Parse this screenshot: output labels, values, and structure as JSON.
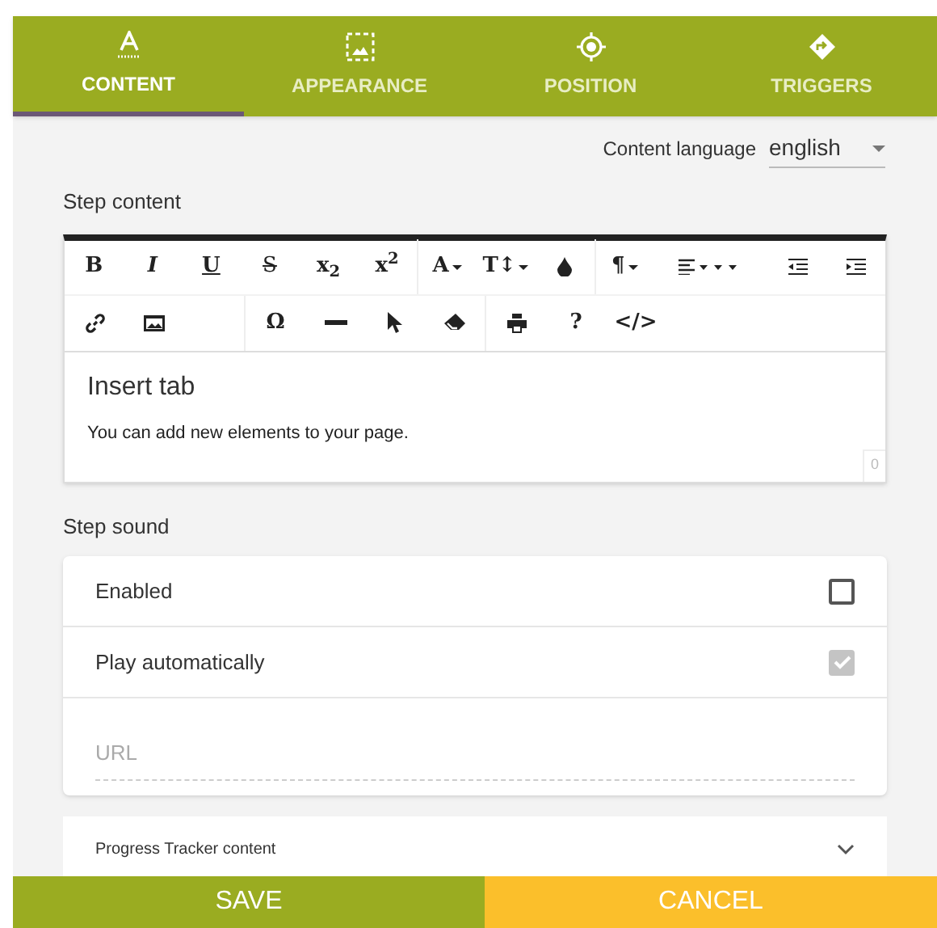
{
  "tabs": [
    {
      "label": "CONTENT",
      "selected": true
    },
    {
      "label": "APPEARANCE",
      "selected": false
    },
    {
      "label": "POSITION",
      "selected": false
    },
    {
      "label": "TRIGGERS",
      "selected": false
    }
  ],
  "content_language": {
    "label": "Content language",
    "value": "english"
  },
  "step_content": {
    "label": "Step content",
    "toolbar_rows": [
      [
        {
          "kind": "bold",
          "label": "B"
        },
        {
          "kind": "italic",
          "label": "I"
        },
        {
          "kind": "underline",
          "label": "U"
        },
        {
          "kind": "strike",
          "label": "S"
        },
        {
          "kind": "text",
          "label": "x$_{2}$"
        },
        {
          "kind": "text",
          "label": "x$^{2}$",
          "sep": true
        },
        {
          "kind": "text",
          "label": "A",
          "caret": true
        },
        {
          "kind": "text",
          "label": "T↕",
          "caret": true
        },
        {
          "kind": "drop",
          "sep": true
        },
        {
          "kind": "text",
          "label": "¶",
          "caret": true
        },
        {
          "kind": "align"
        },
        {
          "kind": "outdent"
        },
        {
          "kind": "indent"
        }
      ],
      [
        {
          "kind": "link"
        },
        {
          "kind": "image"
        },
        {
          "kind": "spacer",
          "sep": true
        },
        {
          "kind": "text",
          "label": "Ω"
        },
        {
          "kind": "hr"
        },
        {
          "kind": "pointer"
        },
        {
          "kind": "eraser",
          "sep": true
        },
        {
          "kind": "print"
        },
        {
          "kind": "text",
          "label": "?"
        },
        {
          "kind": "text",
          "label": "</>"
        }
      ]
    ],
    "heading": "Insert tab",
    "body": "You can add new elements to your page.",
    "count": "0"
  },
  "step_sound": {
    "label": "Step sound",
    "options": [
      {
        "label": "Enabled",
        "checked": false,
        "disabled": false
      },
      {
        "label": "Play automatically",
        "checked": true,
        "disabled": true
      }
    ],
    "url": {
      "placeholder": "URL"
    }
  },
  "progress_tracker": {
    "label": "Progress Tracker content",
    "expanded": false
  },
  "buttons": [
    {
      "label": "SAVE",
      "kind": "primary"
    },
    {
      "label": "CANCEL",
      "kind": "secondary"
    }
  ]
}
